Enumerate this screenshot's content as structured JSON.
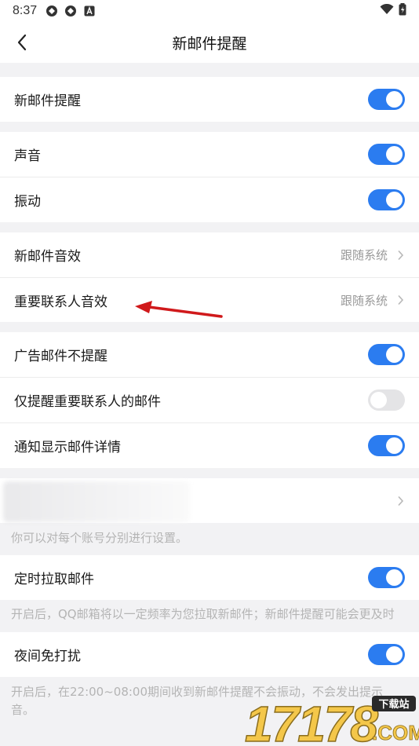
{
  "status_bar": {
    "time": "8:37"
  },
  "header": {
    "title": "新邮件提醒"
  },
  "rows": {
    "new_mail": {
      "label": "新邮件提醒",
      "on": true
    },
    "sound": {
      "label": "声音",
      "on": true
    },
    "vibrate": {
      "label": "振动",
      "on": true
    },
    "mail_sound": {
      "label": "新邮件音效",
      "value": "跟随系统"
    },
    "vip_sound": {
      "label": "重要联系人音效",
      "value": "跟随系统"
    },
    "ad_mail": {
      "label": "广告邮件不提醒",
      "on": true
    },
    "vip_only": {
      "label": "仅提醒重要联系人的邮件",
      "on": false
    },
    "show_detail": {
      "label": "通知显示邮件详情",
      "on": true
    },
    "timed_fetch": {
      "label": "定时拉取邮件",
      "on": true
    },
    "night_dnd": {
      "label": "夜间免打扰",
      "on": true
    }
  },
  "notes": {
    "account": "你可以对每个账号分别进行设置。",
    "timed_fetch": "开启后，QQ邮箱将以一定频率为您拉取新邮件；新邮件提醒可能会更及时",
    "night_dnd": "开启后，在22:00~08:00期间收到新邮件提醒不会振动，不会发出提示音。"
  },
  "watermark": {
    "number": "17178",
    "badge": "下载站",
    "domain": ".COM"
  },
  "colors": {
    "accent": "#2b7cf0",
    "annotation_arrow": "#d0191b"
  }
}
